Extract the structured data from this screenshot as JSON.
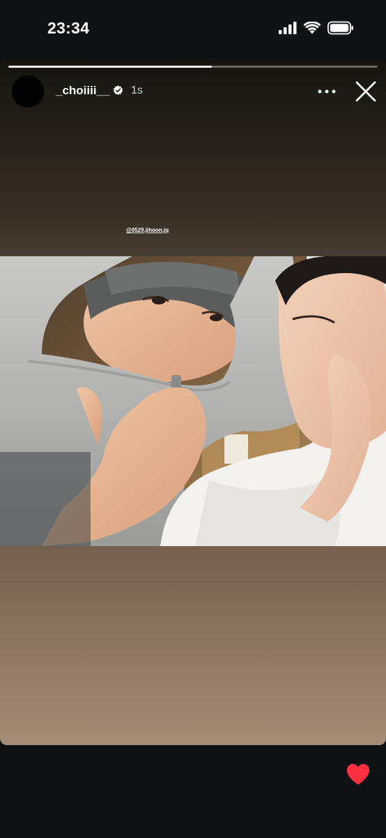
{
  "status_bar": {
    "time": "23:34",
    "icons": [
      "cellular-signal-icon",
      "wifi-icon",
      "battery-icon"
    ]
  },
  "story": {
    "progress": 0.55,
    "user": {
      "username": "_choiiii__",
      "verified": true,
      "time_ago": "1s"
    },
    "mention_sticker": "@0529.jihoon.jq",
    "actions": {
      "more_icon": "more-dots-icon",
      "close_icon": "close-icon",
      "like_icon": "heart-filled-icon"
    }
  },
  "colors": {
    "background": "#0f1214",
    "like_red": "#ff3040",
    "progress_fill": "#f2f2f2"
  }
}
